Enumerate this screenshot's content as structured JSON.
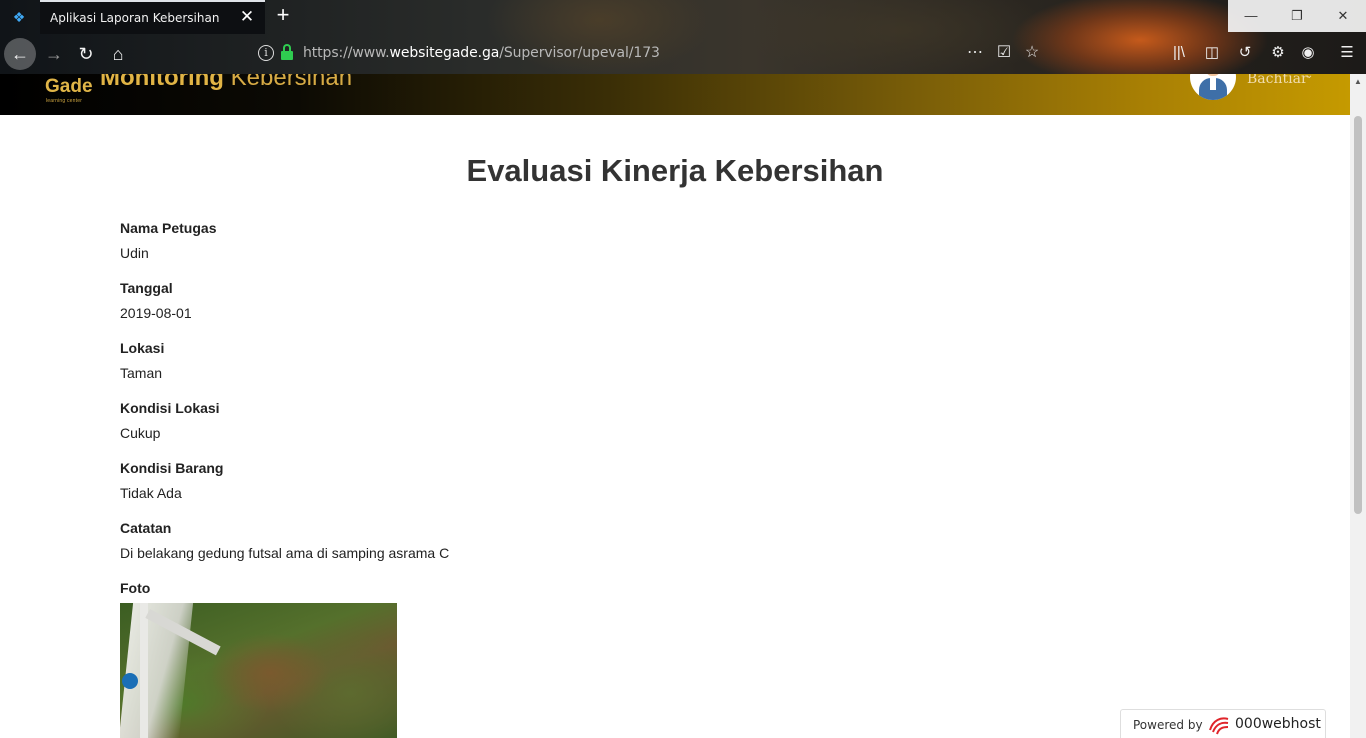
{
  "browser": {
    "tab_title": "Aplikasi Laporan Kebersihan",
    "url_prefix": "https://www.",
    "url_domain": "websitegade.ga",
    "url_path": "/Supervisor/upeval/173",
    "icons": {
      "back": "back-arrow-icon",
      "forward": "forward-arrow-icon",
      "reload": "reload-icon",
      "home": "home-icon",
      "more": "more-dots-icon",
      "pocket": "pocket-icon",
      "bookmark": "star-icon",
      "library": "library-icon",
      "reader": "sidebar-icon",
      "sync": "sync-icon",
      "extension": "extension-icon",
      "account": "account-icon",
      "menu": "hamburger-menu-icon"
    }
  },
  "header": {
    "logo_text": "Gade",
    "logo_sub": "learning center",
    "title_strong": "Monitoring",
    "title_light": "Kebersihan",
    "user_name": "Bachtiar"
  },
  "main": {
    "title": "Evaluasi Kinerja Kebersihan",
    "fields": [
      {
        "label": "Nama Petugas",
        "value": "Udin"
      },
      {
        "label": "Tanggal",
        "value": "2019-08-01"
      },
      {
        "label": "Lokasi",
        "value": "Taman"
      },
      {
        "label": "Kondisi Lokasi",
        "value": "Cukup"
      },
      {
        "label": "Kondisi Barang",
        "value": "Tidak Ada"
      },
      {
        "label": "Catatan",
        "value": "Di belakang gedung futsal ama di samping asrama C"
      }
    ],
    "photo_label": "Foto"
  },
  "badge": {
    "text": "Powered by",
    "brand": "000webhost"
  },
  "colors": {
    "header_gold": "#c59a00",
    "title_gold": "#e1b445",
    "lock_green": "#2fcc50"
  }
}
